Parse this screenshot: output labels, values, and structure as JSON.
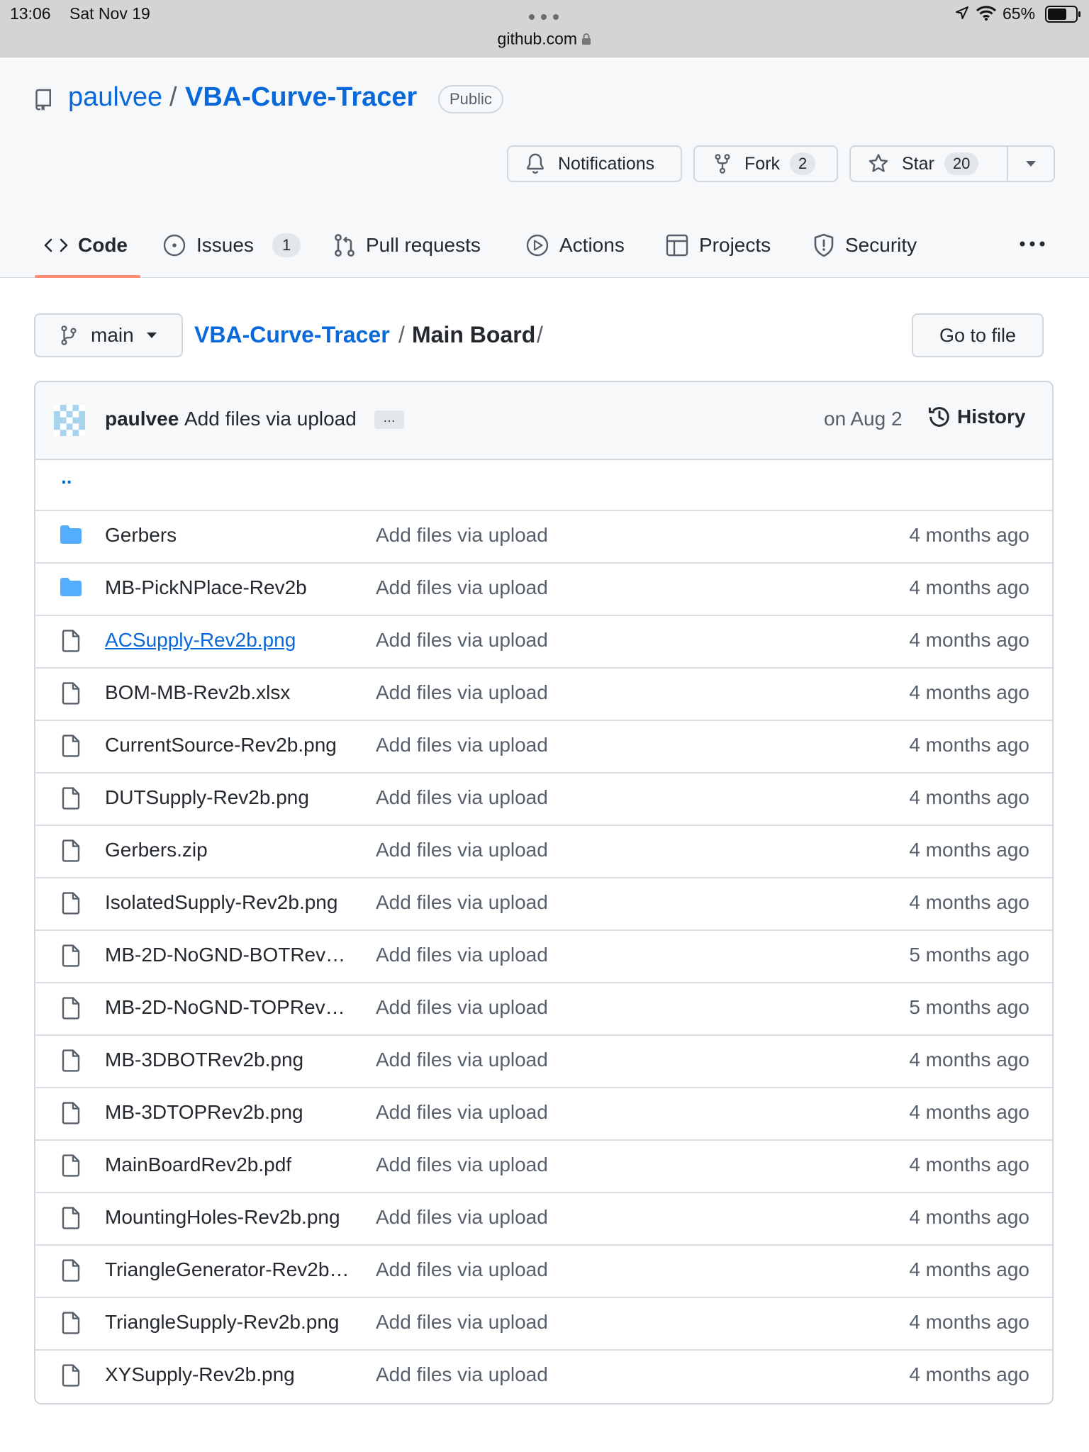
{
  "status_bar": {
    "time": "13:06",
    "date": "Sat Nov 19",
    "battery": "65%",
    "url": "github.com"
  },
  "repo": {
    "owner": "paulvee",
    "name": "VBA-Curve-Tracer",
    "visibility": "Public"
  },
  "actions": {
    "notifications": "Notifications",
    "fork": "Fork",
    "fork_count": "2",
    "star": "Star",
    "star_count": "20"
  },
  "tabs": [
    {
      "label": "Code",
      "icon": "code-icon"
    },
    {
      "label": "Issues",
      "icon": "issue-icon",
      "count": "1"
    },
    {
      "label": "Pull requests",
      "icon": "pull-request-icon"
    },
    {
      "label": "Actions",
      "icon": "play-icon"
    },
    {
      "label": "Projects",
      "icon": "table-icon"
    },
    {
      "label": "Security",
      "icon": "shield-icon"
    }
  ],
  "branch": "main",
  "breadcrumb": {
    "root": "VBA-Curve-Tracer",
    "sep1": "/",
    "current": "Main Board",
    "sep2": "/"
  },
  "go_to_file": "Go to file",
  "commit": {
    "author": "paulvee",
    "message": "Add files via upload",
    "ellipsis": "…",
    "date": "on Aug 2",
    "history": "History"
  },
  "parent_dir": "..",
  "files": [
    {
      "name": "Gerbers",
      "type": "folder",
      "message": "Add files via upload",
      "age": "4 months ago"
    },
    {
      "name": "MB-PickNPlace-Rev2b",
      "type": "folder",
      "message": "Add files via upload",
      "age": "4 months ago"
    },
    {
      "name": "ACSupply-Rev2b.png",
      "type": "file",
      "message": "Add files via upload",
      "age": "4 months ago"
    },
    {
      "name": "BOM-MB-Rev2b.xlsx",
      "type": "file",
      "message": "Add files via upload",
      "age": "4 months ago"
    },
    {
      "name": "CurrentSource-Rev2b.png",
      "type": "file",
      "message": "Add files via upload",
      "age": "4 months ago"
    },
    {
      "name": "DUTSupply-Rev2b.png",
      "type": "file",
      "message": "Add files via upload",
      "age": "4 months ago"
    },
    {
      "name": "Gerbers.zip",
      "type": "file",
      "message": "Add files via upload",
      "age": "4 months ago"
    },
    {
      "name": "IsolatedSupply-Rev2b.png",
      "type": "file",
      "message": "Add files via upload",
      "age": "4 months ago"
    },
    {
      "name": "MB-2D-NoGND-BOTRev…",
      "type": "file",
      "message": "Add files via upload",
      "age": "5 months ago"
    },
    {
      "name": "MB-2D-NoGND-TOPRev…",
      "type": "file",
      "message": "Add files via upload",
      "age": "5 months ago"
    },
    {
      "name": "MB-3DBOTRev2b.png",
      "type": "file",
      "message": "Add files via upload",
      "age": "4 months ago"
    },
    {
      "name": "MB-3DTOPRev2b.png",
      "type": "file",
      "message": "Add files via upload",
      "age": "4 months ago"
    },
    {
      "name": "MainBoardRev2b.pdf",
      "type": "file",
      "message": "Add files via upload",
      "age": "4 months ago"
    },
    {
      "name": "MountingHoles-Rev2b.png",
      "type": "file",
      "message": "Add files via upload",
      "age": "4 months ago"
    },
    {
      "name": "TriangleGenerator-Rev2b…",
      "type": "file",
      "message": "Add files via upload",
      "age": "4 months ago"
    },
    {
      "name": "TriangleSupply-Rev2b.png",
      "type": "file",
      "message": "Add files via upload",
      "age": "4 months ago"
    },
    {
      "name": "XYSupply-Rev2b.png",
      "type": "file",
      "message": "Add files via upload",
      "age": "4 months ago"
    }
  ],
  "colors": {
    "link": "#0969da",
    "folder": "#54aeff",
    "tab_underline": "#fd8c73"
  }
}
